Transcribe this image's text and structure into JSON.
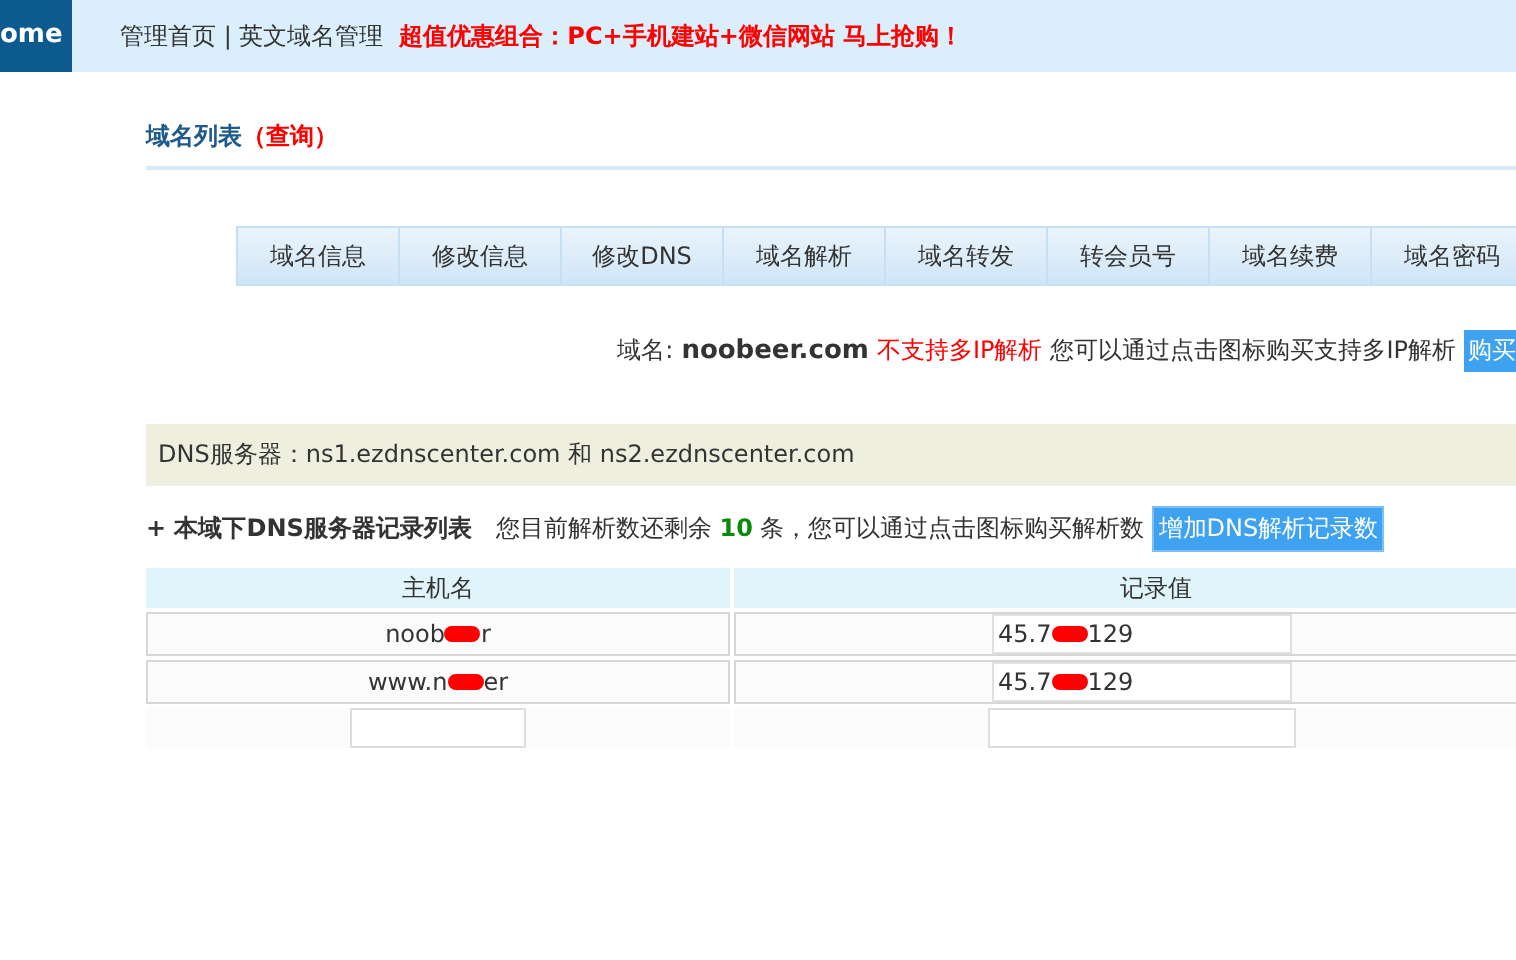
{
  "top_bar": {
    "home_tab": "ome",
    "nav": "管理首页 | 英文域名管理",
    "promo": "超值优惠组合：PC+手机建站+微信网站 马上抢购！"
  },
  "section_title": {
    "text": "域名列表",
    "link": "（查询）"
  },
  "tabs": [
    {
      "label": "域名信息",
      "selected": false
    },
    {
      "label": "修改信息",
      "selected": false
    },
    {
      "label": "修改DNS",
      "selected": false
    },
    {
      "label": "域名解析",
      "selected": false
    },
    {
      "label": "域名转发",
      "selected": false
    },
    {
      "label": "转会员号",
      "selected": false
    },
    {
      "label": "域名续费",
      "selected": false
    },
    {
      "label": "域名密码",
      "selected": false
    }
  ],
  "domain_line": {
    "label": "域名:",
    "domain": "noobeer.com",
    "warning": "不支持多IP解析",
    "hint": "您可以通过点击图标购买支持多IP解析",
    "button": "购买"
  },
  "dns_servers": "DNS服务器：ns1.ezdnscenter.com 和 ns2.ezdnscenter.com",
  "records": {
    "title": "+ 本域下DNS服务器记录列表",
    "remaining": "您目前解析数还剩余 **10** 条，您可以通过点击图标购买解析数",
    "button": "增加DNS解析记录数",
    "columns": [
      "主机名",
      "记录值"
    ],
    "rows": [
      {
        "host": [
          "noob",
          "r"
        ],
        "value": [
          "45.7",
          "129"
        ]
      },
      {
        "host": [
          "www.n",
          "er"
        ],
        "value": [
          "45.7",
          "129"
        ]
      }
    ]
  }
}
